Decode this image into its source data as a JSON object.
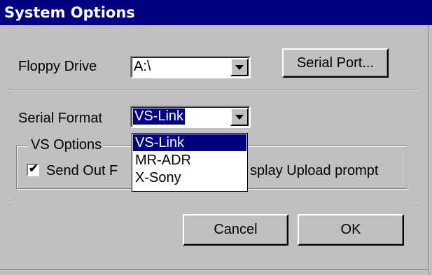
{
  "window": {
    "title": "System Options"
  },
  "floppy": {
    "label": "Floppy Drive",
    "value": "A:\\"
  },
  "serial_port_button": "Serial Port...",
  "serial_format": {
    "label": "Serial Format",
    "value": "VS-Link",
    "options": [
      "VS-Link",
      "MR-ADR",
      "X-Sony"
    ],
    "highlighted": "VS-Link"
  },
  "vs_options": {
    "title": "VS Options",
    "send_out_label": "Send Out F",
    "send_out_checked": true,
    "upload_prompt_label": "splay Upload prompt"
  },
  "buttons": {
    "cancel": "Cancel",
    "ok": "OK"
  },
  "colors": {
    "face": "#c0c0c0",
    "title_bar": "#000080",
    "highlight": "#000080"
  }
}
